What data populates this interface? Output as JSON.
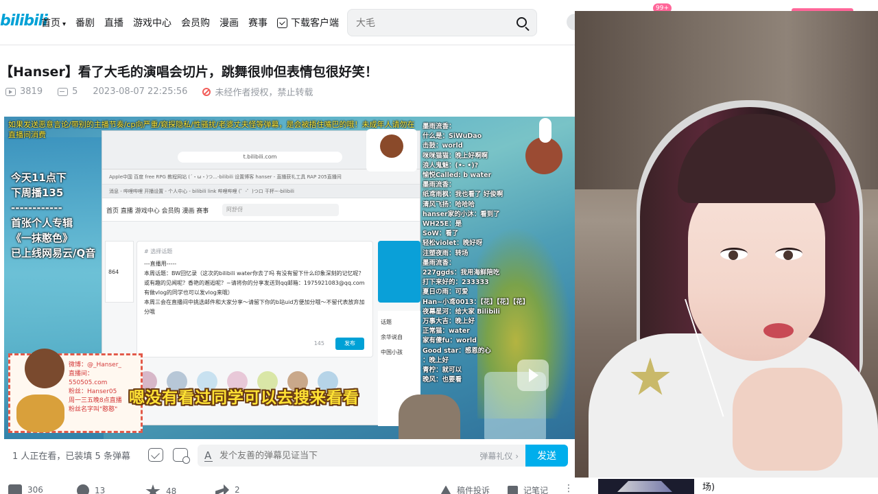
{
  "header": {
    "logo": "bilibili",
    "nav": [
      {
        "label": "首页",
        "dropdown": true
      },
      {
        "label": "番剧"
      },
      {
        "label": "直播"
      },
      {
        "label": "游戏中心"
      },
      {
        "label": "会员购"
      },
      {
        "label": "漫画"
      },
      {
        "label": "赛事"
      },
      {
        "label": "下载客户端"
      }
    ],
    "search_placeholder": "大毛",
    "notification_badge": "99+"
  },
  "video_info": {
    "title": "【Hanser】看了大毛的演唱会切片，跳舞很帅但表情包很好笑！",
    "plays": "3819",
    "comments": "5",
    "datetime": "2023-08-07 22:25:56",
    "copyright": "未经作者授权，禁止转载"
  },
  "player": {
    "notice": "如果发送恶意言论/带别的主播节奏/cp向严重/窥探隐私/性骚扰/老婆丈夫怪等弹幕，是会被捂住嘴巴的哦！未成年人请勿在直播间消费",
    "left_overlay": "今天11点下\n下周播135\n------------\n首张个人专辑\n《一抹憨色》\n已上线网易云/Q音",
    "subtitle": "嗯没有看过同学可以去搜来看看",
    "sticker_text": "微博：@_Hanser_\n直播间：\n550505.com\n粉丝：Hanser05\n周一三五晚8点直播\n粉丝名字叫\"憨憨\"",
    "browser_url": "t.bilibili.com",
    "bookmarks": "Apple中国   百度   free RPG   教程网站  (´・ω・)つ...-bilibili   设置博客   hanser - 直播获礼工具   RAP   205直播间",
    "tabs": "消息 - 哔哩哔哩     开播设置 - 个人中心 - bilibili link     哔哩哔哩 (゜-゜)つロ 干杯~-bilibili",
    "inner_nav": "首页  直播  游戏中心  会员购  漫画  赛事",
    "inner_search": "阿舒伢",
    "post_tag": "# 选择话题",
    "post_body": "---直播用-----\n本周话题：BW回忆录（这次的bilibili water你去了吗 有没有留下什么印象深刻的记忆呢？或有趣的见闻呢？香艳的邂逅呢？~请将你的分享发送到qq邮箱：1975921083@qq.com 有做vlog的同学也可以发vlog来哦）\n本周三会在直播间中挑选邮件和大家分享～请留下你的b站uid方便加分哦～不留代表放弃加分哦",
    "post_count": "145",
    "post_send": "发布",
    "left_card_num": "864",
    "topics_title": "话题",
    "topics": [
      "余华说自",
      "中国小孩"
    ],
    "chat_log": [
      "墨雨流香：",
      "什么是：SiWuDao",
      "击鼓：world",
      "咪咪猫猫：晚上好啊啊",
      "浪人鬼魅：(•- •)?",
      "愉悦Called: b water",
      "墨雨流香：",
      "纸鸢雨枫：我也看了 好俊啊",
      "清风飞扬：哈哈哈",
      "hanser家的小沐：看到了",
      "WH25E：是",
      "SoW：看了",
      "轻松violet：晚好呀",
      "注塑夜雨：转场",
      "墨雨流香：",
      "227ggds：我用海鲜陪吃",
      "打下来好的：233333",
      "夏日の雨：可爱",
      "Han~小鸢0013：【花】【花】【花】",
      "夜幕星河：给大家 Bilibili",
      "万事大吉：晚上好",
      "正常猫：water",
      "家有傻fu：world",
      "Good star：感恩的心",
      "：晚上好",
      "青柠：就可以",
      "晚风：也要看"
    ]
  },
  "danmaku_bar": {
    "viewers": "1 人正在看，已装填 5 条弹幕",
    "input_placeholder": "发个友善的弹幕见证当下",
    "etiquette": "弹幕礼仪 ›",
    "send": "发送"
  },
  "toolbar": {
    "likes": "306",
    "coins": "13",
    "favorites": "48",
    "shares": "2",
    "report": "稿件投诉",
    "notes": "记笔记"
  },
  "bottom_right_text": "场)"
}
